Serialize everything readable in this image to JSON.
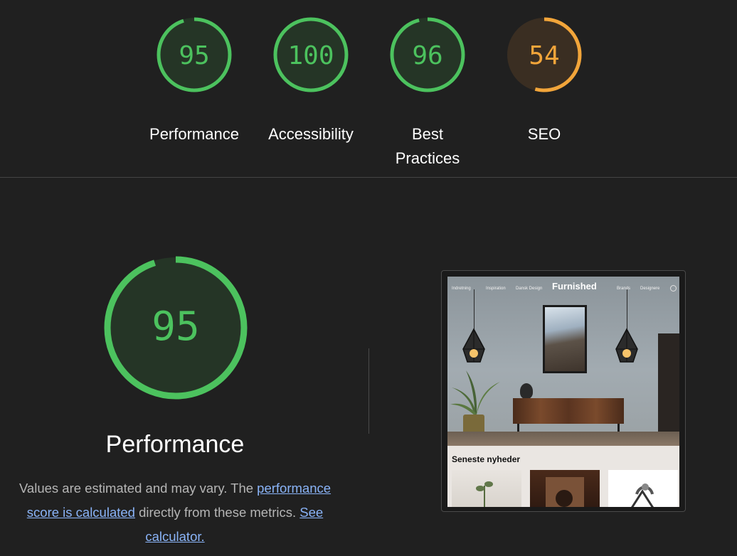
{
  "colors": {
    "pass": "#4cc25e",
    "pass_bg": "#253526",
    "average": "#f2a53a",
    "average_bg": "#3a2e22",
    "link": "#8ab4f8"
  },
  "gauges": [
    {
      "score": "95",
      "label": "Performance",
      "status": "pass",
      "fraction": 0.95
    },
    {
      "score": "100",
      "label": "Accessibility",
      "status": "pass",
      "fraction": 1.0
    },
    {
      "score": "96",
      "label": "Best Practices",
      "status": "pass",
      "fraction": 0.96
    },
    {
      "score": "54",
      "label": "SEO",
      "status": "average",
      "fraction": 0.54
    }
  ],
  "detail": {
    "score": "95",
    "fraction": 0.95,
    "title": "Performance",
    "desc_part1": "Values are estimated and may vary. The ",
    "score_link": "performance score is calculated",
    "desc_part2": " directly from these metrics. ",
    "calc_link": "See calculator."
  },
  "thumbnail": {
    "logo": "Furnished",
    "nav_left": [
      "Indretning",
      "Inspiration",
      "Dansk Design"
    ],
    "nav_right": [
      "Brands",
      "Designere"
    ],
    "section_title": "Seneste nyheder",
    "search_icon": "search-icon"
  }
}
